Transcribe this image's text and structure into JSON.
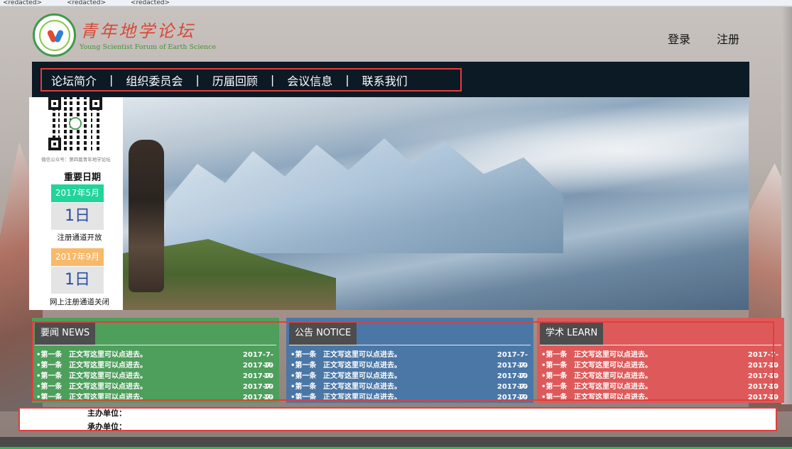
{
  "browser_menu": {
    "items": [
      "<redacted>",
      "<redacted>",
      "<redacted>"
    ]
  },
  "header": {
    "title": "青年地学论坛",
    "subtitle": "Young Scientist Forum of Earth Science",
    "login": "登录",
    "register": "注册"
  },
  "nav": {
    "items": [
      "论坛简介",
      "组织委员会",
      "历届回顾",
      "会议信息",
      "联系我们"
    ],
    "separator": "|"
  },
  "sidebar": {
    "wechat_caption": "微信公众号：第四届青年地学论坛",
    "key_dates_title": "重要日期",
    "dates": [
      {
        "month": "2017年5月",
        "day": "1日",
        "desc": "注册通道开放",
        "color": "#22d49a"
      },
      {
        "month": "2017年9月",
        "day": "1日",
        "desc": "网上注册通道关闭",
        "color": "#f7b96a"
      }
    ]
  },
  "panels": [
    {
      "title": "要闻 NEWS",
      "color": "#4e9e5c",
      "rows": [
        {
          "num": "•第一条",
          "text": "正文写这里可以点进去。",
          "date": "2017-7-10"
        },
        {
          "num": "•第一条",
          "text": "正文写这里可以点进去。",
          "date": "2017-7-10"
        },
        {
          "num": "•第一条",
          "text": "正文写这里可以点进去。",
          "date": "2017-7-10"
        },
        {
          "num": "•第一条",
          "text": "正文写这里可以点进去。",
          "date": "2017-7-10"
        },
        {
          "num": "•第一条",
          "text": "正文写这里可以点进去。",
          "date": "2017-7-10"
        }
      ]
    },
    {
      "title": "公告 NOTICE",
      "color": "#4b77a6",
      "rows": [
        {
          "num": "•第一条",
          "text": "正文写这里可以点进去。",
          "date": "2017-7-10"
        },
        {
          "num": "•第一条",
          "text": "正文写这里可以点进去。",
          "date": "2017-7-10"
        },
        {
          "num": "•第一条",
          "text": "正文写这里可以点进去。",
          "date": "2017-7-10"
        },
        {
          "num": "•第一条",
          "text": "正文写这里可以点进去。",
          "date": "2017-7-10"
        },
        {
          "num": "•第一条",
          "text": "正文写这里可以点进去。",
          "date": "2017-7-10"
        }
      ]
    },
    {
      "title": "学术 LEARN",
      "color": "#de5a5a",
      "rows": [
        {
          "num": "•第一条",
          "text": "正文写这里可以点进去。",
          "date": "2017-7-10"
        },
        {
          "num": "•第一条",
          "text": "正文写这里可以点进去。",
          "date": "2017-7-10"
        },
        {
          "num": "•第一条",
          "text": "正文写这里可以点进去。",
          "date": "2017-7-10"
        },
        {
          "num": "•第一条",
          "text": "正文写这里可以点进去。",
          "date": "2017-7-10"
        },
        {
          "num": "•第一条",
          "text": "正文写这里可以点进去。",
          "date": "2017-7-10"
        }
      ]
    }
  ],
  "footer": {
    "organizer": "主办单位：",
    "co_organizer": "承办单位："
  }
}
